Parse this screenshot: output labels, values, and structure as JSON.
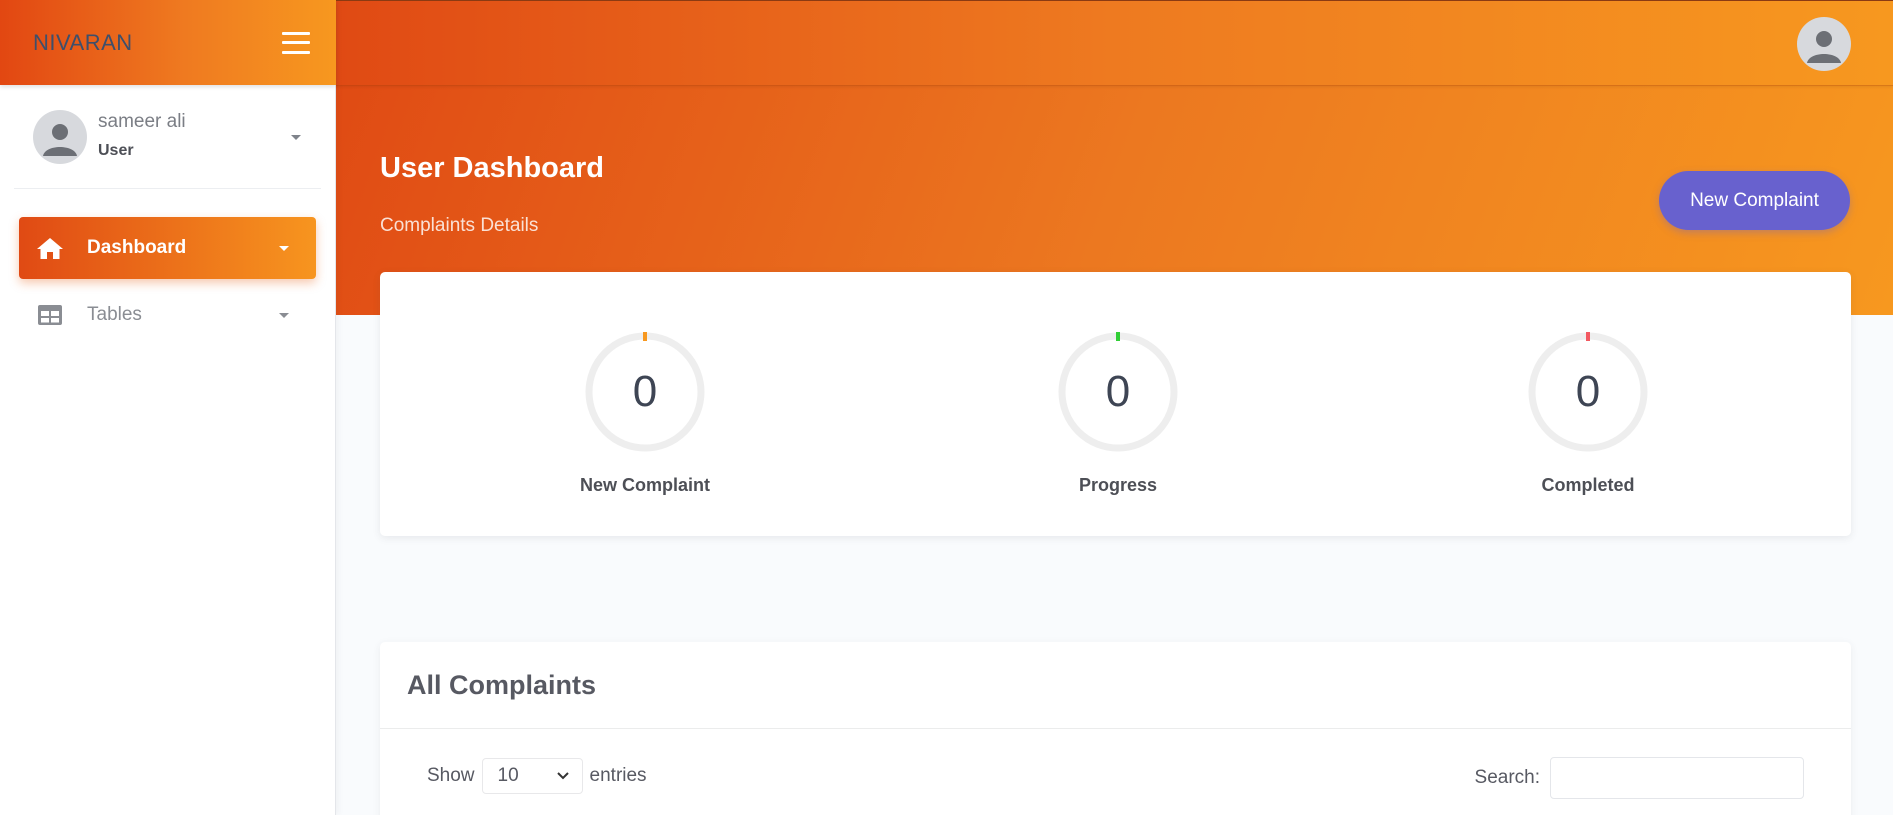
{
  "brand": {
    "name": "NIVARAN"
  },
  "user": {
    "name": "sameer ali",
    "role": "User"
  },
  "sidebar": {
    "items": [
      {
        "label": "Dashboard",
        "icon": "home-icon",
        "active": true
      },
      {
        "label": "Tables",
        "icon": "table-icon",
        "active": false
      }
    ]
  },
  "header": {
    "title": "User Dashboard",
    "subtitle": "Complaints Details",
    "new_button_label": "New Complaint"
  },
  "stats": [
    {
      "value": "0",
      "label": "New Complaint",
      "color": "#f7981f"
    },
    {
      "value": "0",
      "label": "Progress",
      "color": "#31ce36"
    },
    {
      "value": "0",
      "label": "Completed",
      "color": "#f25961"
    }
  ],
  "complaints": {
    "title": "All Complaints",
    "show_label": "Show",
    "entries_value": "10",
    "entries_label": "entries",
    "search_label": "Search:",
    "search_value": ""
  },
  "colors": {
    "accent_orange": "#f7981f",
    "accent_red_orange": "#e04a14",
    "button_purple": "#6861ce"
  }
}
